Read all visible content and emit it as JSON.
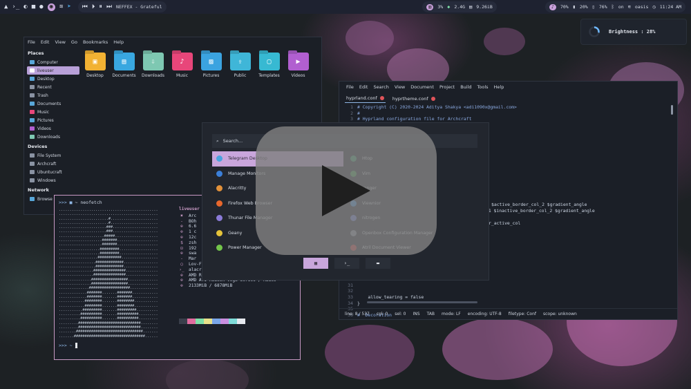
{
  "topbar": {
    "left_icons": [
      "arch-logo-icon",
      "terminal-icon",
      "moon-icon",
      "folder-icon",
      "firefox-icon",
      "pink-app-icon",
      "wifi-icon",
      "telegram-icon",
      "prev-icon",
      "play-icon",
      "pause-icon",
      "next-icon"
    ],
    "now_playing": "NEFFEX - Grateful",
    "cpu": "3%",
    "gpu_freq": "2.4G",
    "memory": "9.26iB",
    "volume": "70%",
    "battery_a": "20%",
    "battery_b": "76%",
    "bluetooth": "on",
    "network": "oasis",
    "clock": "11:24 AM"
  },
  "osd": {
    "label": "Brightness : 28%",
    "level": 0.28
  },
  "file_manager": {
    "menu": [
      "File",
      "Edit",
      "View",
      "Go",
      "Bookmarks",
      "Help"
    ],
    "places_header": "Places",
    "places": [
      "Computer",
      "liveuser",
      "Desktop",
      "Recent",
      "Trash",
      "Documents",
      "Music",
      "Pictures",
      "Videos",
      "Downloads"
    ],
    "devices_header": "Devices",
    "devices": [
      "File System",
      "Archcraft",
      "Ubuntucraft",
      "Windows"
    ],
    "network_header": "Network",
    "network": [
      "Browse"
    ],
    "folders": [
      {
        "label": "Desktop",
        "color": "#f2b233"
      },
      {
        "label": "Documents",
        "color": "#39a7e0"
      },
      {
        "label": "Downloads",
        "color": "#7ec8b2"
      },
      {
        "label": "Music",
        "color": "#e8467a"
      },
      {
        "label": "Pictures",
        "color": "#3ba3e0"
      },
      {
        "label": "Public",
        "color": "#3fb6d8"
      },
      {
        "label": "Templates",
        "color": "#37b9d2"
      },
      {
        "label": "Videos",
        "color": "#b15fd0"
      }
    ]
  },
  "terminal": {
    "prompt": ">>>",
    "command": "~ neofetch",
    "user": "liveuser",
    "info": [
      "Arc",
      "BOh",
      "6.6",
      "1 c",
      "12c",
      "zsh",
      "192",
      "swa",
      "Mar",
      "Lov-Folders-Dark (8fk2/J)",
      "alacritty",
      "AMD Ryzen 5 3500U with Radeon Vega",
      "AMD ATI Radeon Vega Series / Radeo",
      "2133MiB / 6878MiB"
    ],
    "info_icons": [
      "✖",
      "-",
      "⊕",
      "⊕",
      "⊕",
      "$",
      "⊡",
      "⊕",
      "-",
      "◯",
      "›_",
      "⊕",
      "⊕",
      "⊕"
    ],
    "palette": [
      "#3a3f4b",
      "#e06c9f",
      "#7ee0a8",
      "#e8e08a",
      "#7aa6e8",
      "#c98fe0",
      "#7fdbd8",
      "#e6e9ef"
    ],
    "prompt2": ">>> ~"
  },
  "editor": {
    "menu": [
      "File",
      "Edit",
      "Search",
      "View",
      "Document",
      "Project",
      "Build",
      "Tools",
      "Help"
    ],
    "tabs": [
      "hyprland.conf",
      "hyprtheme.conf"
    ],
    "lines": [
      "# Copyright (C) 2020-2024 Aditya Shakya <adi1090x@gmail.com>",
      "#",
      "# Hyprland configuration file for Archcraft",
      "",
      "",
      "",
      "",
      "",
      "",
      "",
      "",
      "",
      "",
      "",
      "",
      "",
      "",
      "",
      "",
      "",
      "",
      "",
      "",
      "",
      "",
      "",
      "",
      "",
      "",
      "",
      "",
      "",
      "    allow_tearing = false",
      "}",
      "",
      "#  Decoration"
    ],
    "visible_fragments": [
      "$active_border_col_2 $gradient_angle",
      "_1 $inactive_border_col_2 $gradient_angle",
      "r_active_col"
    ],
    "line_numbers": [
      "1",
      "2",
      "3",
      "4",
      "5",
      "6",
      "7",
      "8",
      "9",
      "10",
      "11",
      "12",
      "13",
      "14",
      "15",
      "16",
      "17",
      "18",
      "19",
      "20",
      "21",
      "22",
      "23",
      "24",
      "25",
      "26",
      "27",
      "28",
      "29",
      "30",
      "31",
      "32",
      "33",
      "34",
      "35",
      "36"
    ],
    "status": [
      "line: 8 / 537",
      "col: 0",
      "sel: 0",
      "INS",
      "TAB",
      "mode: LF",
      "encoding: UTF-8",
      "filetype: Conf",
      "scope: unknown"
    ]
  },
  "launcher": {
    "placeholder": "Search...",
    "left": [
      {
        "label": "Telegram Desktop",
        "color": "#4aa3df"
      },
      {
        "label": "Manage Monitors",
        "color": "#3b7fd8"
      },
      {
        "label": "Alacritty",
        "color": "#e2913a"
      },
      {
        "label": "Firefox Web Browser",
        "color": "#e8672c"
      },
      {
        "label": "Thunar File Manager",
        "color": "#8b7bd8"
      },
      {
        "label": "Geany",
        "color": "#e5c33a"
      },
      {
        "label": "Power Manager",
        "color": "#73c54a"
      }
    ],
    "right": [
      {
        "label": "Htop",
        "color": "#3aa36b"
      },
      {
        "label": "Vim",
        "color": "#3fa34c"
      },
      {
        "label": "ranger",
        "color": "#5a6170"
      },
      {
        "label": "Viewnior",
        "color": "#3a8ee0"
      },
      {
        "label": "nitrogen",
        "color": "#6f7fe0"
      },
      {
        "label": "Openbox Configuration Manager",
        "color": "#8a93a3"
      },
      {
        "label": "Atril Document Viewer",
        "color": "#d23a3a"
      }
    ],
    "modes": [
      "▦",
      "›_",
      "▬"
    ]
  }
}
